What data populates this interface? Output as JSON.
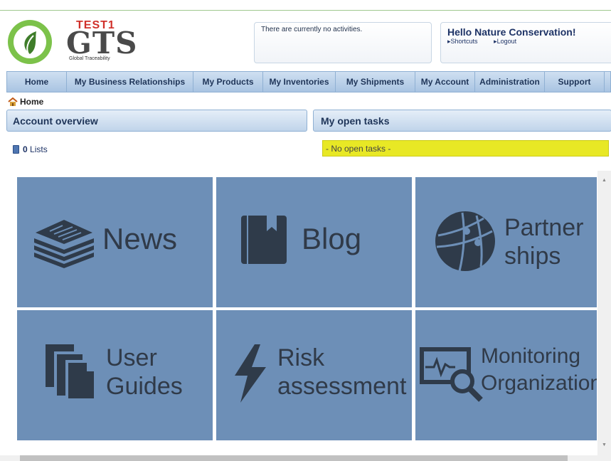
{
  "header": {
    "logo_test": "TEST1",
    "logo_name": "GTS",
    "logo_sub": "Global Traceability",
    "activity_text": "There are currently no activities.",
    "greeting": "Hello Nature Conservation!",
    "links": [
      "Shortcuts",
      "Logout"
    ]
  },
  "nav": {
    "items": [
      "Home",
      "My Business Relationships",
      "My Products",
      "My Inventories",
      "My Shipments",
      "My Account",
      "Administration",
      "Support"
    ]
  },
  "breadcrumb": {
    "label": "Home"
  },
  "panels": {
    "account_overview": "Account overview",
    "open_tasks": "My open tasks"
  },
  "lists": {
    "count": "0",
    "label": "Lists"
  },
  "tasks": {
    "empty": "- No open tasks -"
  },
  "tiles": [
    {
      "label_lines": [
        "News"
      ],
      "icon": "newspaper-icon"
    },
    {
      "label_lines": [
        "Blog"
      ],
      "icon": "book-icon"
    },
    {
      "label_lines": [
        "Partner",
        "ships"
      ],
      "icon": "globe-network-icon"
    },
    {
      "label_lines": [
        "User",
        "Guides"
      ],
      "icon": "documents-icon"
    },
    {
      "label_lines": [
        "Risk",
        "assessment"
      ],
      "icon": "lightning-icon"
    },
    {
      "label_lines": [
        "Monitoring",
        "Organization"
      ],
      "icon": "monitor-search-icon"
    }
  ],
  "colors": {
    "tile_bg": "#6d8fb7",
    "nav_text": "#1f3559",
    "tasks_bg": "#e8e825"
  }
}
